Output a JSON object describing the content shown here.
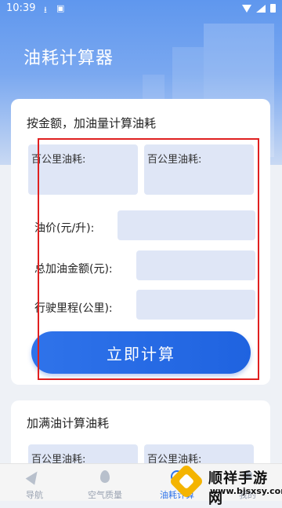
{
  "status_bar": {
    "time": "10:39",
    "download_icon": "download-icon",
    "a_icon": "a-badge-icon"
  },
  "header": {
    "title": "油耗计算器"
  },
  "card1": {
    "title": "按金额，加油量计算油耗",
    "result_left_label": "百公里油耗:",
    "result_right_label": "百公里油耗:",
    "price_label": "油价(元/升):",
    "amount_label": "总加油金额(元):",
    "mileage_label": "行驶里程(公里):",
    "price_value": "",
    "amount_value": "",
    "mileage_value": "",
    "submit_label": "立即计算"
  },
  "card2": {
    "title": "加满油计算油耗",
    "result_left_label": "百公里油耗:",
    "result_right_label": "百公里油耗:"
  },
  "tabbar": {
    "items": [
      {
        "label": "导航",
        "icon": "navigation-icon",
        "active": false
      },
      {
        "label": "空气质量",
        "icon": "leaf-icon",
        "active": false
      },
      {
        "label": "油耗计算",
        "icon": "fuel-gauge-icon",
        "active": true
      },
      {
        "label": "我的",
        "icon": "person-icon",
        "active": false
      }
    ]
  },
  "watermark": {
    "title": "顺祥手游网",
    "url": "www.bjsxsy.com"
  },
  "colors": {
    "accent": "#2f73ea",
    "highlight_box": "#e02020",
    "field_bg": "#dfe6f6"
  }
}
